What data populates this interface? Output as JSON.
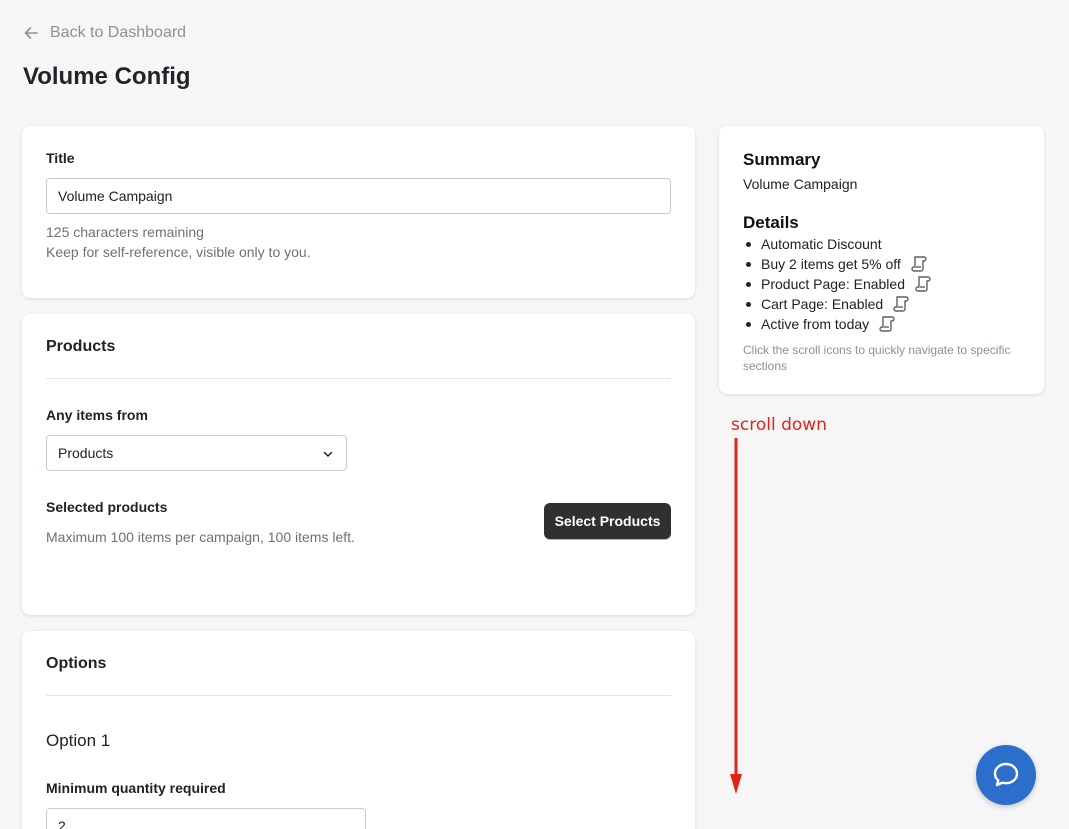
{
  "nav": {
    "back_label": "Back to Dashboard"
  },
  "page": {
    "title": "Volume Config"
  },
  "title_card": {
    "label": "Title",
    "value": "Volume Campaign",
    "chars_remaining": "125 characters remaining",
    "help": "Keep for self-reference, visible only to you."
  },
  "products_card": {
    "heading": "Products",
    "any_items_label": "Any items from",
    "select_value": "Products",
    "selected_label": "Selected products",
    "selected_help": "Maximum 100 items per campaign, 100 items left.",
    "select_button": "Select Products"
  },
  "options_card": {
    "heading": "Options",
    "option_title": "Option 1",
    "min_qty_label": "Minimum quantity required",
    "min_qty_value": "2"
  },
  "summary": {
    "heading": "Summary",
    "campaign": "Volume Campaign",
    "details_heading": "Details",
    "items": [
      {
        "text": "Automatic Discount",
        "icon": ""
      },
      {
        "text": "Buy 2 items get 5% off",
        "icon": "scroll-icon"
      },
      {
        "text": "Product Page: Enabled",
        "icon": "scroll-icon"
      },
      {
        "text": "Cart Page: Enabled",
        "icon": "scroll-icon"
      },
      {
        "text": "Active from today",
        "icon": "scroll-icon"
      }
    ],
    "note": "Click the scroll icons to quickly navigate to specific sections"
  },
  "annotation": {
    "text": "scroll down",
    "color": "#e0241b"
  },
  "chat": {
    "icon": "chat-bubble-icon",
    "color": "#2c6ecb"
  }
}
